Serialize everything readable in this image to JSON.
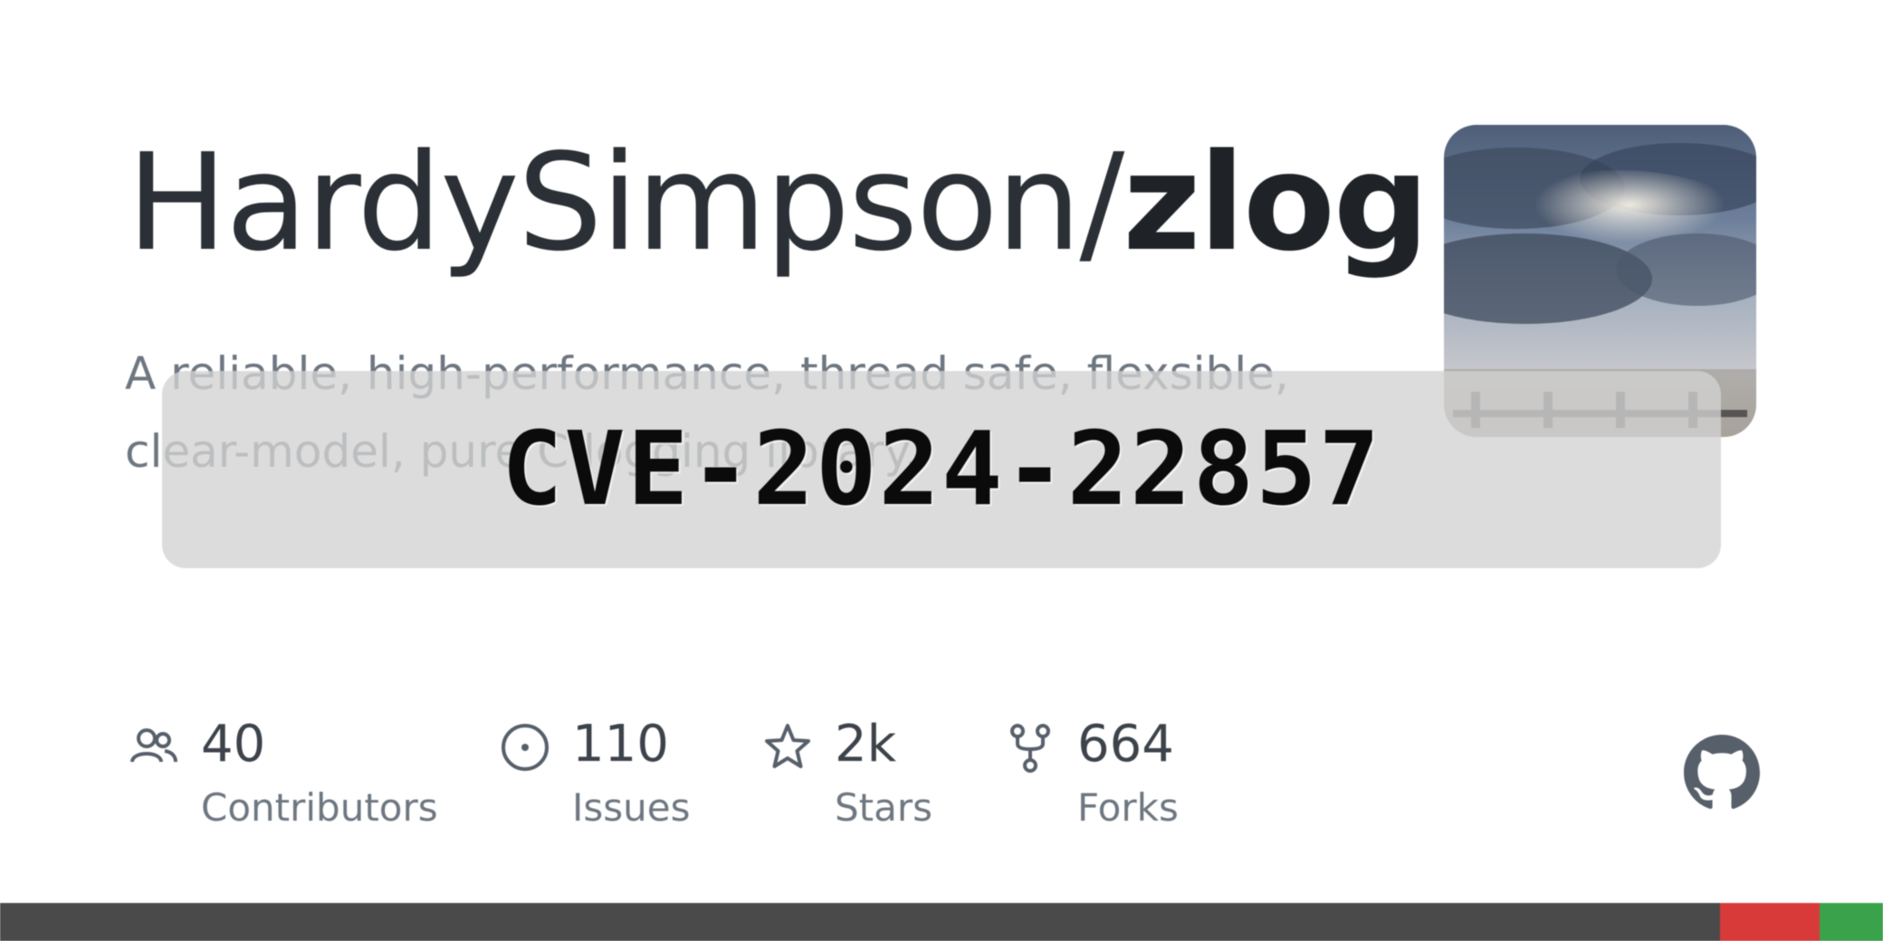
{
  "repo": {
    "owner": "HardySimpson",
    "separator": "/",
    "name": "zlog",
    "description": "A reliable, high-performance, thread safe, flexsible, clear-model, pure C logging library."
  },
  "overlay": {
    "text": "CVE-2024-22857"
  },
  "stats": {
    "contributors": {
      "value": "40",
      "label": "Contributors",
      "icon": "people-icon"
    },
    "issues": {
      "value": "110",
      "label": "Issues",
      "icon": "issue-icon"
    },
    "stars": {
      "value": "2k",
      "label": "Stars",
      "icon": "star-icon"
    },
    "forks": {
      "value": "664",
      "label": "Forks",
      "icon": "fork-icon"
    }
  },
  "branding": {
    "icon": "github-mark-icon"
  },
  "colors": {
    "title": "#24292f",
    "muted": "#6e7781",
    "overlay_bg": "#d2d2d2",
    "bar": "#4a4a4a",
    "bar_red": "#d83a3a",
    "bar_green": "#3aa24a"
  }
}
